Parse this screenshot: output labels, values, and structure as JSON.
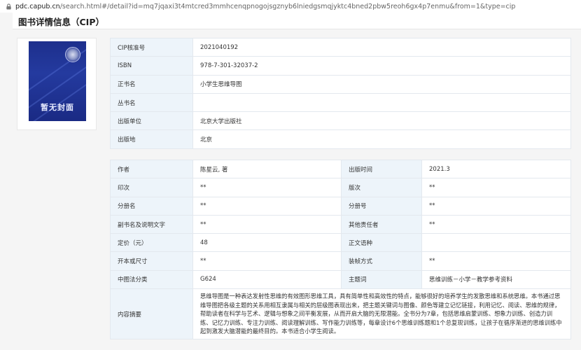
{
  "browser": {
    "host": "pdc.capub.cn",
    "path": "/search.html#/detail?id=mq7jqaxi3t4mtcred3mmhcenqpnogojsgznyb6lniedgsmqjyktc4bned2pbw5reoh6gx4p7enmu&from=1&type=cip"
  },
  "page": {
    "title": "图书详情信息（CIP）"
  },
  "cover": {
    "placeholder_text": "暂无封面"
  },
  "basic_info": [
    {
      "label": "CIP核准号",
      "value": "2021040192"
    },
    {
      "label": "ISBN",
      "value": "978-7-301-32037-2"
    },
    {
      "label": "正书名",
      "value": "小学生思维导图"
    },
    {
      "label": "丛书名",
      "value": ""
    },
    {
      "label": "出版单位",
      "value": "北京大学出版社"
    },
    {
      "label": "出版地",
      "value": "北京"
    }
  ],
  "detail_rows": [
    {
      "l1": "作者",
      "v1": "陈星云, 著",
      "l2": "出版时间",
      "v2": "2021.3"
    },
    {
      "l1": "印次",
      "v1": "**",
      "l2": "版次",
      "v2": "**"
    },
    {
      "l1": "分册名",
      "v1": "**",
      "l2": "分册号",
      "v2": "**"
    },
    {
      "l1": "副书名及说明文字",
      "v1": "**",
      "l2": "其他责任者",
      "v2": "**"
    },
    {
      "l1": "定价（元）",
      "v1": "48",
      "l2": "正文语种",
      "v2": ""
    },
    {
      "l1": "开本或尺寸",
      "v1": "**",
      "l2": "装帧方式",
      "v2": "**"
    },
    {
      "l1": "中图法分类",
      "v1": "G624",
      "l2": "主题词",
      "v2": "思维训练－小学－教学参考资料"
    }
  ],
  "abstract": {
    "label": "内容摘要",
    "text": "思维导图是一种表达发射性思维的有效图形思维工具，具有简单性和高效性的特点，能够很好的培养学生的发散思维和系统思维。本书通过思维导图把各级主题的关系用相互隶属与相关的层级图表现出来，把主题关键词与图像、颜色等建立记忆链接，利用记忆、阅读、思维的规律，帮助读者在科学与艺术、逻辑与想象之间平衡发展，从而开启大脑的无限潜能。全书分为7章，包括思维启蒙训练、想象力训练、创造力训练、记忆力训练、专注力训练、阅读理解训练、写作能力训练等，每章设计6个思维训练题和1个总复现训练，让孩子在循序渐进的思维训练中起到激发大脑潜能的最终目的。本书适合小学生阅读。"
  }
}
